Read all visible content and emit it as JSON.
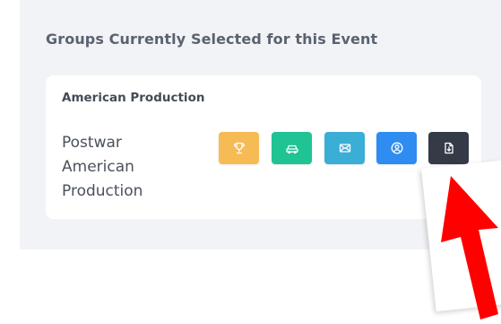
{
  "section": {
    "title": "Groups Currently Selected for this Event"
  },
  "group": {
    "name": "American Production",
    "description": "Postwar American Production"
  },
  "actions": [
    {
      "icon": "trophy-icon",
      "color": "#f7bb55"
    },
    {
      "icon": "car-icon",
      "color": "#1fc394"
    },
    {
      "icon": "envelope-icon",
      "color": "#3baed6"
    },
    {
      "icon": "user-circle-icon",
      "color": "#2f8cf0"
    },
    {
      "icon": "file-download-icon",
      "color": "#343b47"
    }
  ],
  "annotation": {
    "arrow_color": "#ff0000"
  }
}
